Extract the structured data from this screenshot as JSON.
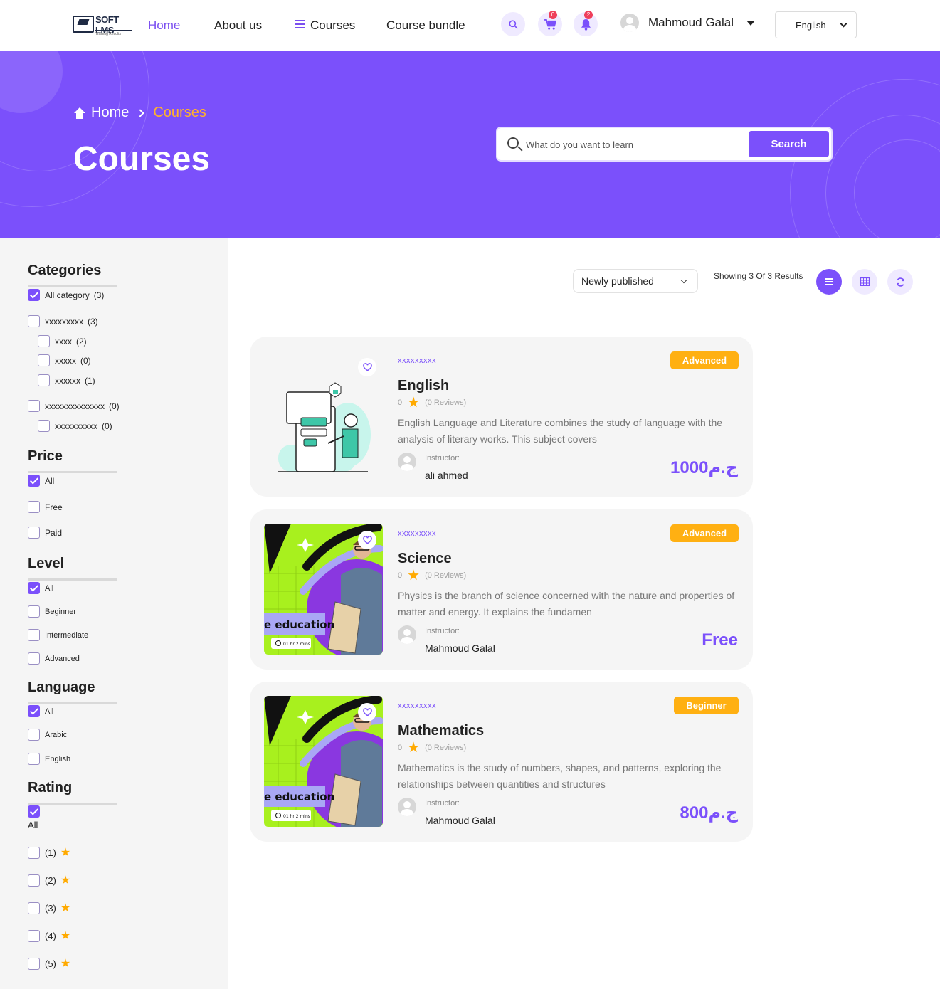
{
  "header": {
    "logo_text": "SOFT LMS",
    "logo_sub": "Training Results",
    "nav": {
      "home": "Home",
      "about": "About us",
      "courses": "Courses",
      "bundle": "Course bundle"
    },
    "cart_count": "0",
    "notification_count": "2",
    "user_name": "Mahmoud Galal",
    "language": "English"
  },
  "hero": {
    "breadcrumb_home": "Home",
    "breadcrumb_current": "Courses",
    "title": "Courses",
    "search_placeholder": "What do you want to learn",
    "search_button": "Search"
  },
  "filters": {
    "categories": {
      "title": "Categories",
      "items": [
        {
          "label": "All category",
          "count": "(3)",
          "checked": true
        },
        {
          "label": "xxxxxxxxx",
          "count": "(3)",
          "checked": false
        },
        {
          "label": "xxxx",
          "count": "(2)",
          "checked": false
        },
        {
          "label": "xxxxx",
          "count": "(0)",
          "checked": false
        },
        {
          "label": "xxxxxx",
          "count": "(1)",
          "checked": false
        },
        {
          "label": "xxxxxxxxxxxxxx",
          "count": "(0)",
          "checked": false
        },
        {
          "label": "xxxxxxxxxx",
          "count": "(0)",
          "checked": false
        }
      ]
    },
    "price": {
      "title": "Price",
      "items": [
        {
          "label": "All",
          "checked": true
        },
        {
          "label": "Free",
          "checked": false
        },
        {
          "label": "Paid",
          "checked": false
        }
      ]
    },
    "level": {
      "title": "Level",
      "items": [
        {
          "label": "All",
          "checked": true
        },
        {
          "label": "Beginner",
          "checked": false
        },
        {
          "label": "Intermediate",
          "checked": false
        },
        {
          "label": "Advanced",
          "checked": false
        }
      ]
    },
    "language": {
      "title": "Language",
      "items": [
        {
          "label": "All",
          "checked": true
        },
        {
          "label": "Arabic",
          "checked": false
        },
        {
          "label": "English",
          "checked": false
        }
      ]
    },
    "rating": {
      "title": "Rating",
      "items": [
        {
          "label": "All",
          "checked": true
        },
        {
          "label": "(1)",
          "checked": false
        },
        {
          "label": "(2)",
          "checked": false
        },
        {
          "label": "(3)",
          "checked": false
        },
        {
          "label": "(4)",
          "checked": false
        },
        {
          "label": "(5)",
          "checked": false
        }
      ]
    }
  },
  "toolbar": {
    "sort_value": "Newly published",
    "results_text": "Showing 3 Of 3 Results"
  },
  "courses": [
    {
      "category": "xxxxxxxxx",
      "level": "Advanced",
      "title": "English",
      "rating_value": "0",
      "reviews": "(0 Reviews)",
      "description": "English Language and Literature combines the study of language with the analysis of literary works. This subject covers",
      "instructor_label": "Instructor:",
      "instructor": "ali ahmed",
      "price": "1000ج.م"
    },
    {
      "category": "xxxxxxxxx",
      "level": "Advanced",
      "title": "Science",
      "rating_value": "0",
      "reviews": "(0 Reviews)",
      "description": "Physics is the branch of science concerned with the nature and properties of matter and energy. It explains the fundamen",
      "instructor_label": "Instructor:",
      "instructor": "Mahmoud Galal",
      "price": "Free",
      "thumb_banner": "e education",
      "thumb_duration": "01 hr 2 mins"
    },
    {
      "category": "xxxxxxxxx",
      "level": "Beginner",
      "title": "Mathematics",
      "rating_value": "0",
      "reviews": "(0 Reviews)",
      "description": "Mathematics is the study of numbers, shapes, and patterns, exploring the relationships between quantities and structures",
      "instructor_label": "Instructor:",
      "instructor": "Mahmoud Galal",
      "price": "800ج.م",
      "thumb_banner": "e education",
      "thumb_duration": "01 hr 2 mins"
    }
  ],
  "colors": {
    "primary": "#7b50fb",
    "accent": "#ffb012",
    "badge": "#ef3f5b"
  }
}
